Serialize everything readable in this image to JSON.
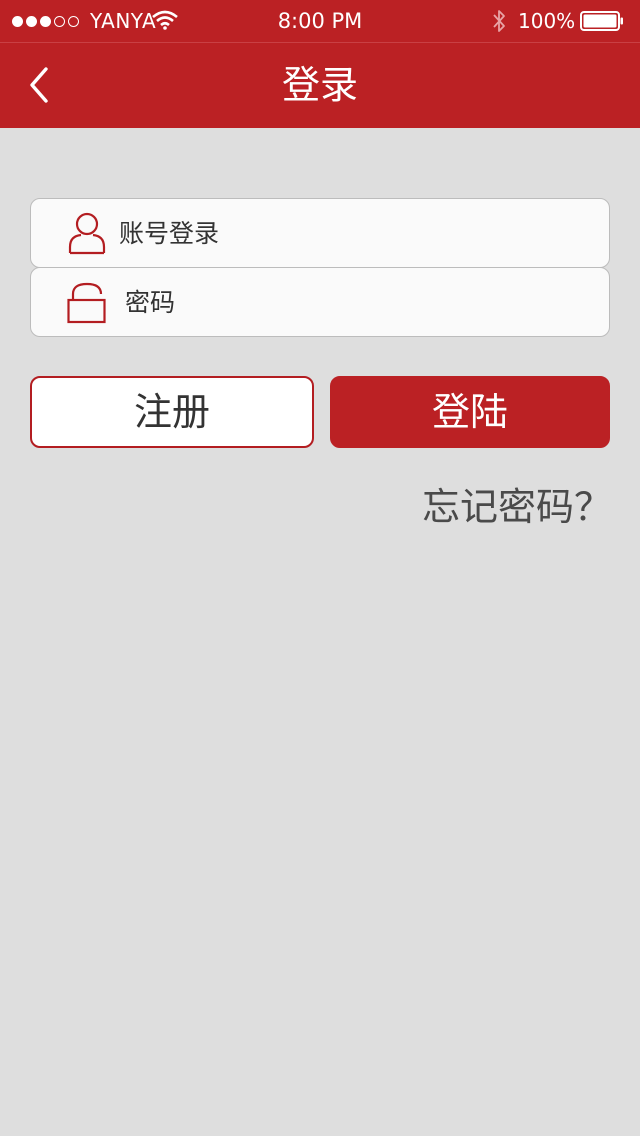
{
  "status_bar": {
    "carrier": "YANYA",
    "time": "8:00 PM",
    "battery": "100%",
    "signal_bars_filled": 3,
    "signal_bars_total": 5
  },
  "nav": {
    "title": "登录",
    "back_icon": "chevron-left-icon"
  },
  "form": {
    "account_placeholder": "账号登录",
    "password_placeholder": "密码",
    "account_icon": "user-icon",
    "password_icon": "lock-icon"
  },
  "buttons": {
    "register": "注册",
    "login": "登陆"
  },
  "forgot_password": "忘记密码？",
  "colors": {
    "brand_red": "#bb2124",
    "background": "#dedede",
    "text": "#333333"
  }
}
